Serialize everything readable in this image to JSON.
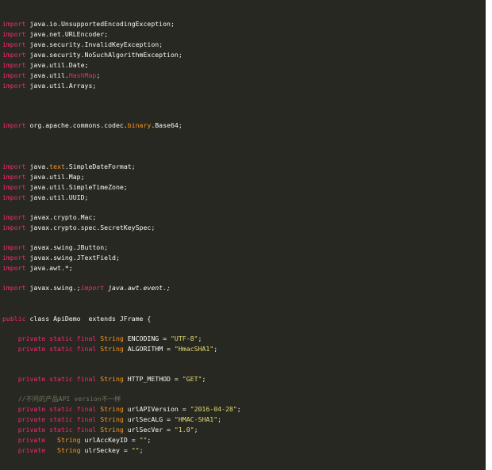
{
  "colors": {
    "background": "#272822",
    "text": "#f8f8f2",
    "keyword": "#f92672",
    "string": "#e6db74",
    "highlight": "#fd971f",
    "comment": "#75715e"
  },
  "code": {
    "lines": [
      [
        {
          "t": "import",
          "c": "kw"
        },
        {
          "t": " java.io.UnsupportedEncodingException;"
        }
      ],
      [
        {
          "t": "import",
          "c": "kw"
        },
        {
          "t": " java.net.URLEncoder;"
        }
      ],
      [
        {
          "t": "import",
          "c": "kw"
        },
        {
          "t": " java.security.InvalidKeyException;"
        }
      ],
      [
        {
          "t": "import",
          "c": "kw"
        },
        {
          "t": " java.security.NoSuchAlgorithmException;"
        }
      ],
      [
        {
          "t": "import",
          "c": "kw"
        },
        {
          "t": " java.util.Date;"
        }
      ],
      [
        {
          "t": "import",
          "c": "kw"
        },
        {
          "t": " java.util."
        },
        {
          "t": "HashMap",
          "c": "kw"
        },
        {
          "t": ";"
        }
      ],
      [
        {
          "t": "import",
          "c": "kw"
        },
        {
          "t": " java.util.Arrays;"
        }
      ],
      [
        {
          "t": "import",
          "c": "kw"
        },
        {
          "t": " org.apache.commons.codec."
        },
        {
          "t": "binary",
          "c": "ty"
        },
        {
          "t": ".Base64;"
        }
      ],
      [
        {
          "t": "import",
          "c": "kw"
        },
        {
          "t": " java."
        },
        {
          "t": "text",
          "c": "ty"
        },
        {
          "t": ".SimpleDateFormat;"
        }
      ],
      [
        {
          "t": "import",
          "c": "kw"
        },
        {
          "t": " java.util.Map;"
        }
      ],
      [
        {
          "t": "import",
          "c": "kw"
        },
        {
          "t": " java.util.SimpleTimeZone;"
        }
      ],
      [
        {
          "t": "import",
          "c": "kw"
        },
        {
          "t": " java.util.UUID;"
        }
      ],
      [
        {
          "t": "import",
          "c": "kw"
        },
        {
          "t": " javax.crypto.Mac;"
        }
      ],
      [
        {
          "t": "import",
          "c": "kw"
        },
        {
          "t": " javax.crypto.spec.SecretKeySpec;"
        }
      ],
      [
        {
          "t": "import",
          "c": "kw"
        },
        {
          "t": " javax.swing.JButton;"
        }
      ],
      [
        {
          "t": "import",
          "c": "kw"
        },
        {
          "t": " javax.swing.JTextField;"
        }
      ],
      [
        {
          "t": "import",
          "c": "kw"
        },
        {
          "t": " java.awt.*;"
        }
      ],
      [
        {
          "t": "import",
          "c": "kw"
        },
        {
          "t": " javax.swing.;"
        },
        {
          "t": "import",
          "c": "kw it"
        },
        {
          "t": " java.awt.event.;",
          "c": "it"
        }
      ],
      [
        {
          "t": "public",
          "c": "kw"
        },
        {
          "t": " class ApiDemo  extends JFrame {"
        }
      ],
      [
        {
          "t": "    "
        },
        {
          "t": "private static final",
          "c": "kw"
        },
        {
          "t": " "
        },
        {
          "t": "String",
          "c": "ty"
        },
        {
          "t": " ENCODING = "
        },
        {
          "t": "\"UTF-8\"",
          "c": "str"
        },
        {
          "t": ";"
        }
      ],
      [
        {
          "t": "    "
        },
        {
          "t": "private static final",
          "c": "kw"
        },
        {
          "t": " "
        },
        {
          "t": "String",
          "c": "ty"
        },
        {
          "t": " ALGORITHM = "
        },
        {
          "t": "\"HmacSHA1\"",
          "c": "str"
        },
        {
          "t": ";"
        }
      ],
      [
        {
          "t": "    "
        },
        {
          "t": "private static final",
          "c": "kw"
        },
        {
          "t": " "
        },
        {
          "t": "String",
          "c": "ty"
        },
        {
          "t": " HTTP_METHOD = "
        },
        {
          "t": "\"GET\"",
          "c": "str"
        },
        {
          "t": ";"
        }
      ],
      [
        {
          "t": "    //不同的产品API version不一样",
          "c": "cmt"
        }
      ],
      [
        {
          "t": "    "
        },
        {
          "t": "private static final",
          "c": "kw"
        },
        {
          "t": " "
        },
        {
          "t": "String",
          "c": "ty"
        },
        {
          "t": " urlAPIVersion = "
        },
        {
          "t": "\"2016-04-28\"",
          "c": "str"
        },
        {
          "t": ";"
        }
      ],
      [
        {
          "t": "    "
        },
        {
          "t": "private static final",
          "c": "kw"
        },
        {
          "t": " "
        },
        {
          "t": "String",
          "c": "ty"
        },
        {
          "t": " urlSecALG = "
        },
        {
          "t": "\"HMAC-SHA1\"",
          "c": "str"
        },
        {
          "t": ";"
        }
      ],
      [
        {
          "t": "    "
        },
        {
          "t": "private static final",
          "c": "kw"
        },
        {
          "t": " "
        },
        {
          "t": "String",
          "c": "ty"
        },
        {
          "t": " urlSecVer = "
        },
        {
          "t": "\"1.0\"",
          "c": "str"
        },
        {
          "t": ";"
        }
      ],
      [
        {
          "t": "    "
        },
        {
          "t": "private",
          "c": "kw"
        },
        {
          "t": "   "
        },
        {
          "t": "String",
          "c": "ty"
        },
        {
          "t": " urlAccKeyID = "
        },
        {
          "t": "\"\"",
          "c": "str"
        },
        {
          "t": ";"
        }
      ],
      [
        {
          "t": "    "
        },
        {
          "t": "private",
          "c": "kw"
        },
        {
          "t": "   "
        },
        {
          "t": "String",
          "c": "ty"
        },
        {
          "t": " ulrSeckey = "
        },
        {
          "t": "\"\"",
          "c": "str"
        },
        {
          "t": ";"
        }
      ]
    ]
  }
}
